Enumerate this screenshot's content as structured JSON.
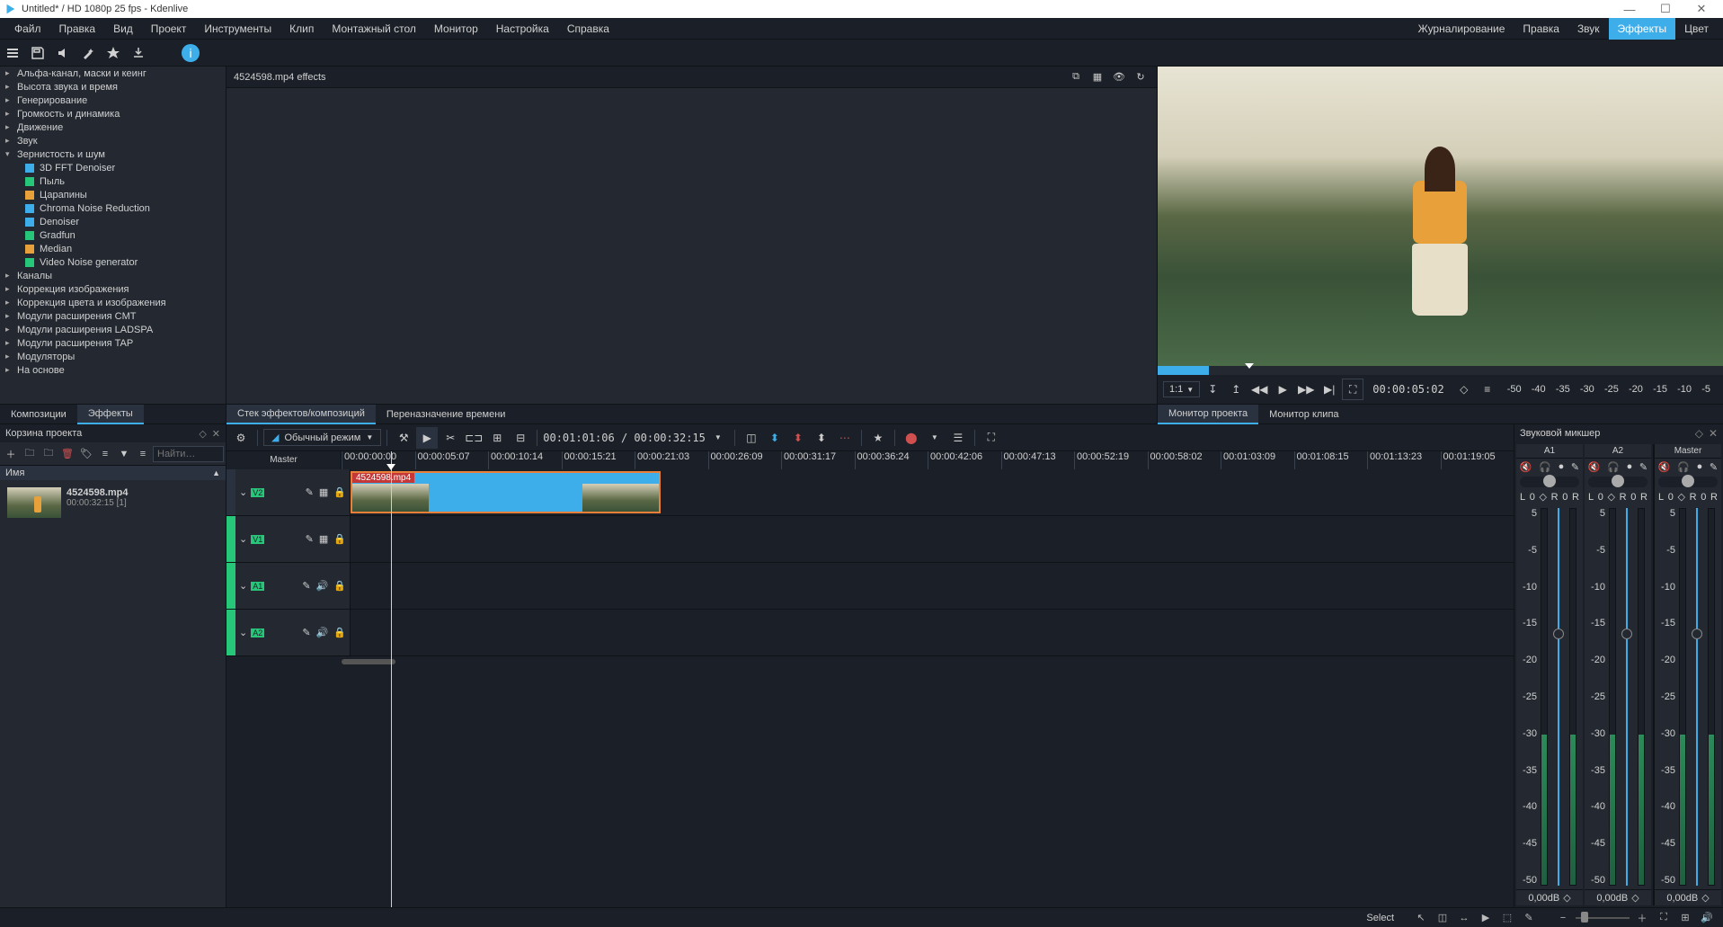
{
  "titlebar": {
    "title": "Untitled* / HD 1080p 25 fps - Kdenlive"
  },
  "menubar": {
    "items": [
      "Файл",
      "Правка",
      "Вид",
      "Проект",
      "Инструменты",
      "Клип",
      "Монтажный стол",
      "Монитор",
      "Настройка",
      "Справка"
    ],
    "right": [
      "Журналирование",
      "Правка",
      "Звук",
      "Эффекты",
      "Цвет"
    ],
    "active_right": 3
  },
  "effects_header": "4524598.mp4 effects",
  "tree": {
    "categories": [
      {
        "label": "Альфа-канал, маски и кеинг",
        "open": false
      },
      {
        "label": "Высота звука и время",
        "open": false
      },
      {
        "label": "Генерирование",
        "open": false
      },
      {
        "label": "Громкость и динамика",
        "open": false
      },
      {
        "label": "Движение",
        "open": false
      },
      {
        "label": "Звук",
        "open": false
      },
      {
        "label": "Зернистость и шум",
        "open": true,
        "children": [
          {
            "label": "3D FFT Denoiser",
            "color": "#3daee9"
          },
          {
            "label": "Пыль",
            "color": "#27c77a"
          },
          {
            "label": "Царапины",
            "color": "#e8a03a"
          },
          {
            "label": "Chroma Noise Reduction",
            "color": "#3daee9"
          },
          {
            "label": "Denoiser",
            "color": "#3daee9"
          },
          {
            "label": "Gradfun",
            "color": "#27c77a"
          },
          {
            "label": "Median",
            "color": "#e8a03a"
          },
          {
            "label": "Video Noise generator",
            "color": "#27c77a"
          }
        ]
      },
      {
        "label": "Каналы",
        "open": false
      },
      {
        "label": "Коррекция изображения",
        "open": false
      },
      {
        "label": "Коррекция цвета и изображения",
        "open": false
      },
      {
        "label": "Модули расширения CMT",
        "open": false
      },
      {
        "label": "Модули расширения LADSPA",
        "open": false
      },
      {
        "label": "Модули расширения TAP",
        "open": false
      },
      {
        "label": "Модуляторы",
        "open": false
      },
      {
        "label": "На основе",
        "open": false
      }
    ]
  },
  "left_tabs": {
    "items": [
      "Композиции",
      "Эффекты"
    ],
    "active": 1
  },
  "mid_tabs": {
    "items": [
      "Стек эффектов/композиций",
      "Переназначение времени"
    ],
    "active": 0
  },
  "monitor_tabs": {
    "items": [
      "Монитор проекта",
      "Монитор клипа"
    ],
    "active": 0
  },
  "monitor": {
    "zoom": "1:1",
    "timecode": "00:00:05:02",
    "ruler": [
      "-50",
      "-40",
      "-35",
      "-30",
      "-25",
      "-20",
      "-15",
      "-10",
      "-5"
    ]
  },
  "bin": {
    "title": "Корзина проекта",
    "search_placeholder": "Найти…",
    "col": "Имя",
    "clip": {
      "name": "4524598.mp4",
      "dur": "00:00:32:15 [1]"
    }
  },
  "timeline": {
    "mode": "Обычный режим",
    "tc": "00:01:01:06  /  00:00:32:15",
    "master": "Master",
    "ticks": [
      "00:00:00:00",
      "00:00:05:07",
      "00:00:10:14",
      "00:00:15:21",
      "00:00:21:03",
      "00:00:26:09",
      "00:00:31:17",
      "00:00:36:24",
      "00:00:42:06",
      "00:00:47:13",
      "00:00:52:19",
      "00:00:58:02",
      "00:01:03:09",
      "00:01:08:15",
      "00:01:13:23",
      "00:01:19:05"
    ],
    "tracks": [
      {
        "id": "V2",
        "type": "video"
      },
      {
        "id": "V1",
        "type": "video"
      },
      {
        "id": "A1",
        "type": "audio"
      },
      {
        "id": "A2",
        "type": "audio"
      }
    ],
    "clip_label": "4524598.mp4"
  },
  "mixer": {
    "title": "Звуковой микшер",
    "channels": [
      {
        "name": "A1"
      },
      {
        "name": "A2"
      },
      {
        "name": "Master"
      }
    ],
    "lr": {
      "L": "L",
      "lval": "0",
      "R": "R",
      "rval": "0"
    },
    "scale": [
      "5",
      "-5",
      "-10",
      "-15",
      "-20",
      "-25",
      "-30",
      "-35",
      "-40",
      "-45",
      "-50"
    ],
    "db": "0,00dB"
  },
  "status": {
    "mode": "Select"
  }
}
